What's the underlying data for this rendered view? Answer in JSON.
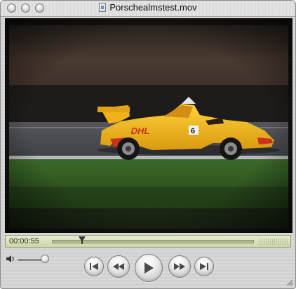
{
  "window": {
    "title": "Porschealmstest.mov",
    "buttons": [
      "close-button",
      "minimize-button",
      "zoom-button"
    ]
  },
  "player": {
    "current_time": "00:00:55",
    "playback_progress": 0.16,
    "volume_level": 0.85
  },
  "controls": {
    "jump_to_start": "jump-to-start-icon",
    "rewind": "rewind-icon",
    "play": "play-icon",
    "fast_forward": "fast-forward-icon",
    "jump_to_end": "jump-to-end-icon"
  },
  "colors": {
    "timebar": "#d6dfb8",
    "car_body": "#f2b71a",
    "car_accent": "#d4301b"
  }
}
